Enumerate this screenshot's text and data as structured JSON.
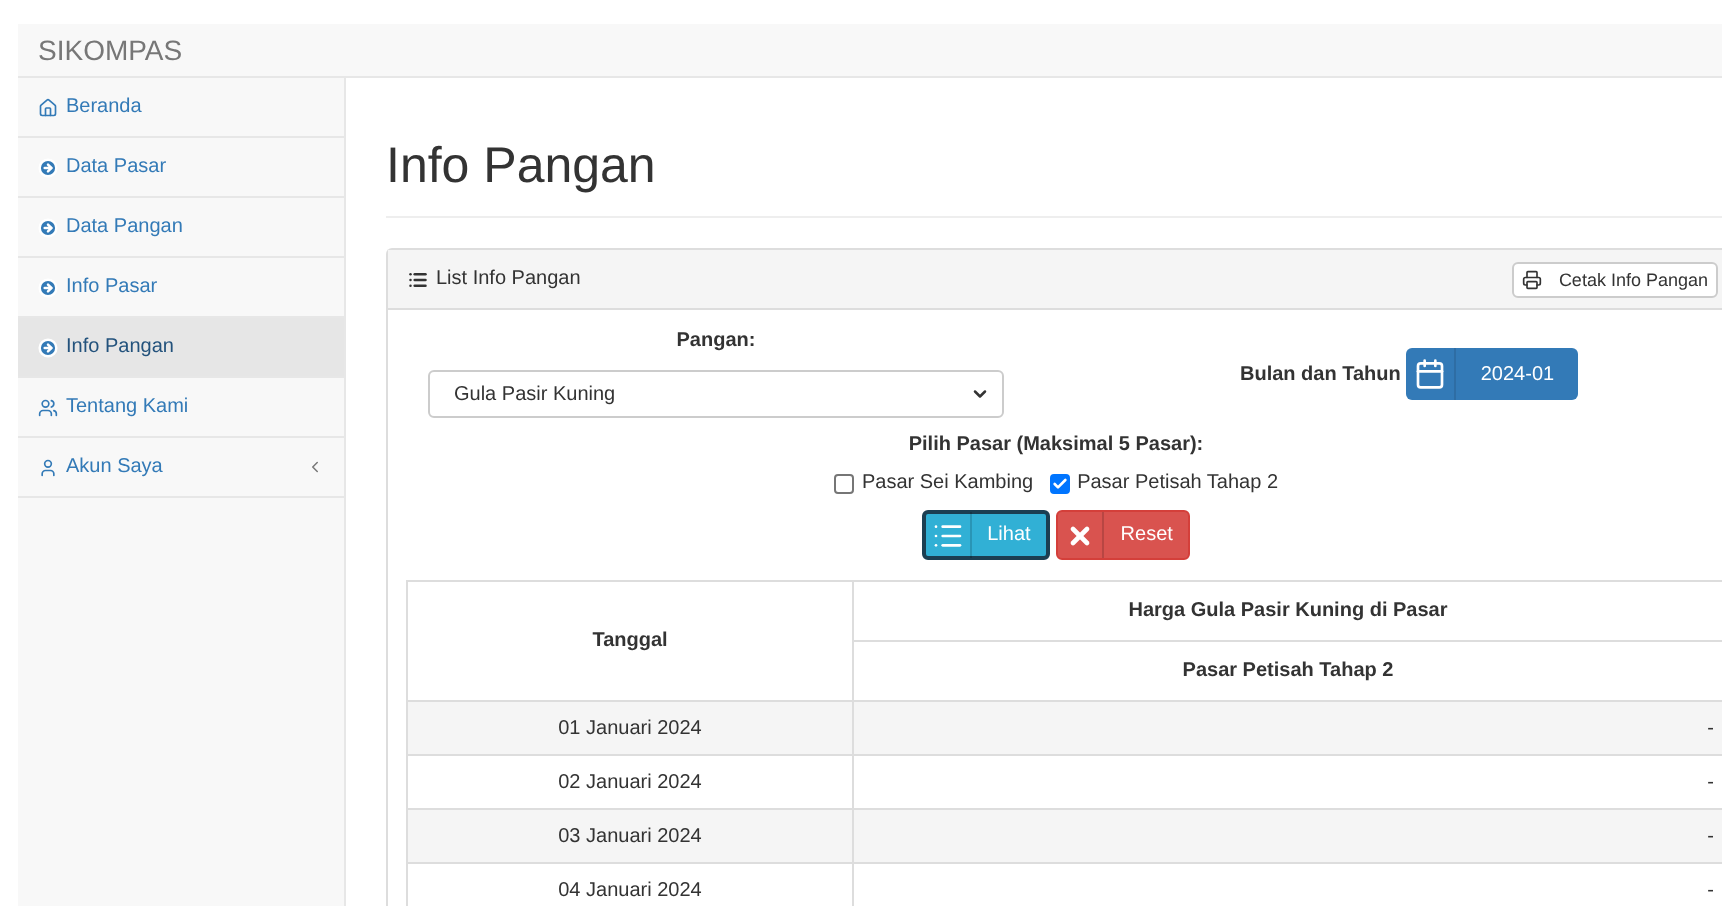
{
  "brand": "SIKOMPAS",
  "sidebar": {
    "items": [
      {
        "label": "Beranda",
        "kind": "home",
        "selected": false,
        "expandable": false
      },
      {
        "label": "Data Pasar",
        "kind": "circle",
        "selected": false,
        "expandable": false
      },
      {
        "label": "Data Pangan",
        "kind": "circle",
        "selected": false,
        "expandable": false
      },
      {
        "label": "Info Pasar",
        "kind": "circle",
        "selected": false,
        "expandable": false
      },
      {
        "label": "Info Pangan",
        "kind": "circle",
        "selected": true,
        "expandable": false
      },
      {
        "label": "Tentang Kami",
        "kind": "users",
        "selected": false,
        "expandable": false
      },
      {
        "label": "Akun Saya",
        "kind": "user",
        "selected": false,
        "expandable": true
      }
    ]
  },
  "page_title": "Info Pangan",
  "panel": {
    "title": "List Info Pangan",
    "print_button": "Cetak Info Pangan",
    "pangan_label": "Pangan:",
    "pangan_value": "Gula Pasir Kuning",
    "period_label": "Bulan dan Tahun",
    "period_value": "2024-01",
    "market_label": "Pilih Pasar (Maksimal 5 Pasar):",
    "markets": [
      {
        "label": "Pasar Sei Kambing",
        "checked": false
      },
      {
        "label": "Pasar Petisah Tahap 2",
        "checked": true
      }
    ],
    "view_button": "Lihat",
    "reset_button": "Reset"
  },
  "table": {
    "date_header": "Tanggal",
    "group_header": "Harga Gula Pasir Kuning di Pasar",
    "columns": [
      "Pasar Petisah Tahap 2"
    ],
    "rows": [
      {
        "date": "01 Januari 2024",
        "values": [
          "-"
        ]
      },
      {
        "date": "02 Januari 2024",
        "values": [
          "-"
        ]
      },
      {
        "date": "03 Januari 2024",
        "values": [
          "-"
        ]
      },
      {
        "date": "04 Januari 2024",
        "values": [
          "-"
        ]
      }
    ]
  }
}
